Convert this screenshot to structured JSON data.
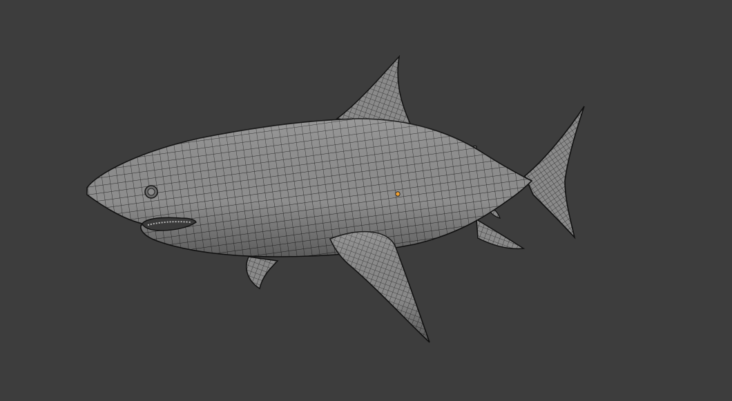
{
  "viewport": {
    "background": "#3d3d3d"
  },
  "model": {
    "object": "shark-icon",
    "shading": "wireframe-on-solid",
    "surface_color": "#8c8c8c",
    "wire_color": "#1a1a1a",
    "origin_color": "#f0a030"
  }
}
